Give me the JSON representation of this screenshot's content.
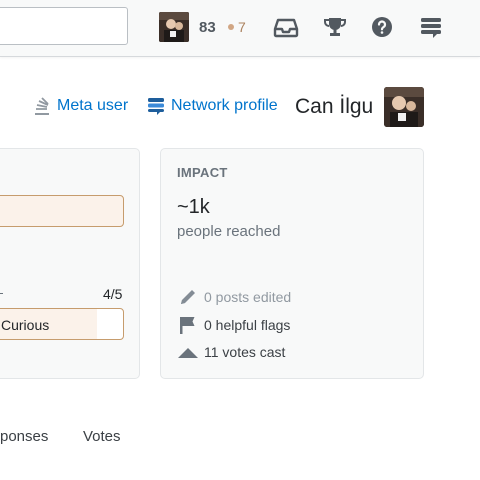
{
  "topbar": {
    "reputation": "83",
    "bronze_count": "7",
    "icons": [
      "inbox-icon",
      "achievements-icon",
      "help-icon",
      "site-switcher-icon"
    ]
  },
  "profile": {
    "meta_link": "Meta user",
    "network_link": "Network profile",
    "display_name": "Can İlgu"
  },
  "badge_progress": {
    "fraction": "4/5",
    "fill_fraction": 0.8,
    "label": "Curious"
  },
  "impact": {
    "title": "IMPACT",
    "reached": "~1k",
    "reached_label": "people reached",
    "stats": [
      {
        "icon": "pencil-icon",
        "text": "0 posts edited",
        "muted": true
      },
      {
        "icon": "flag-icon",
        "text": "0 helpful flags",
        "muted": false
      },
      {
        "icon": "vote-arrow-icon",
        "text": "11 votes cast",
        "muted": false
      }
    ]
  },
  "tabs": [
    "ponses",
    "Votes"
  ],
  "colors": {
    "link": "#0074cc",
    "bronze": "#ab825f",
    "badge_border": "#c69c6d",
    "badge_fill": "#fbf2ea"
  }
}
